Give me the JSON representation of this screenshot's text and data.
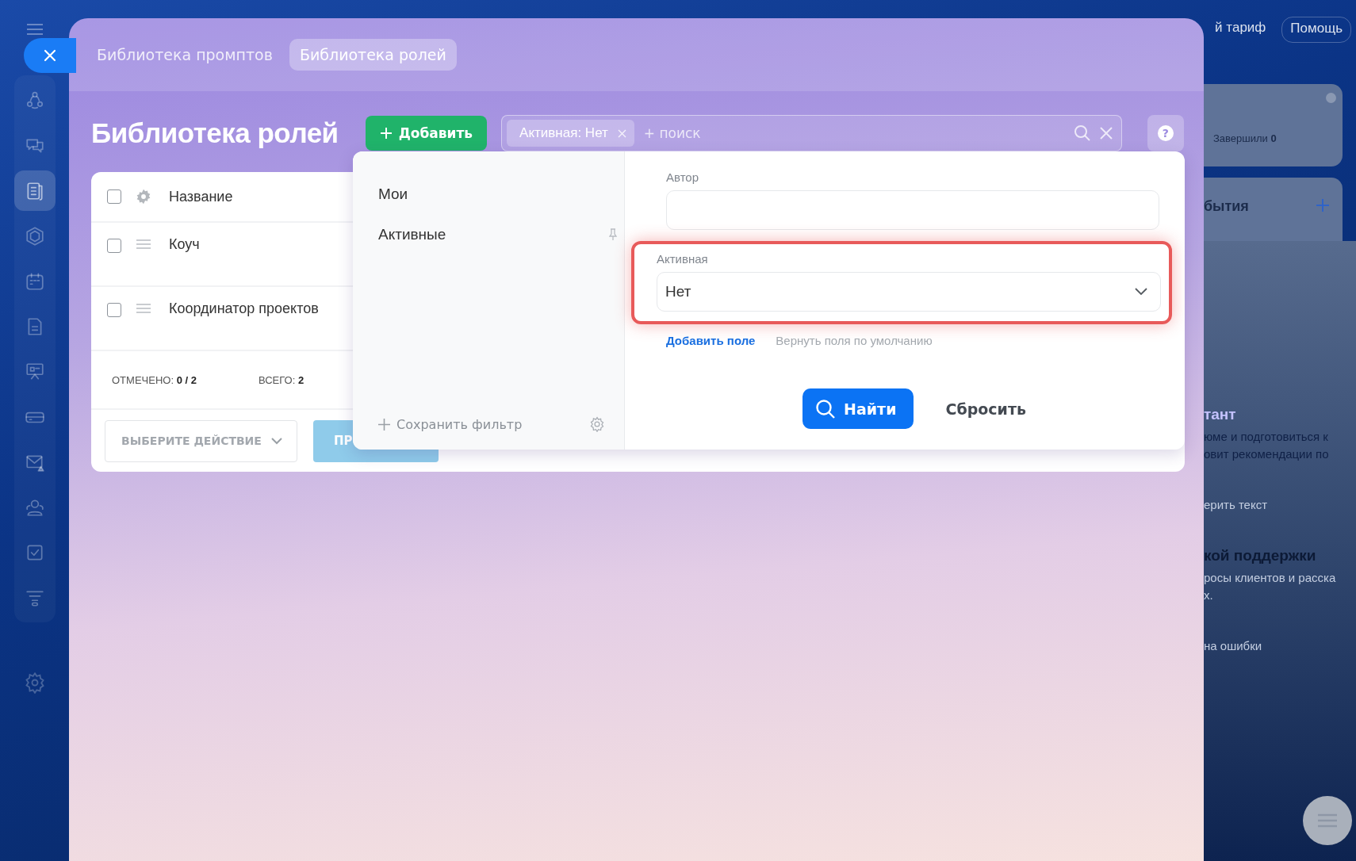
{
  "sidebar": {
    "items": [
      {
        "kind": "network",
        "selected": false
      },
      {
        "kind": "chat",
        "selected": false
      },
      {
        "kind": "document",
        "selected": true
      },
      {
        "kind": "hexagon",
        "selected": false
      },
      {
        "kind": "calendar",
        "selected": false
      },
      {
        "kind": "file",
        "selected": false
      },
      {
        "kind": "presentation",
        "selected": false
      },
      {
        "kind": "drive",
        "selected": false
      },
      {
        "kind": "mail",
        "selected": false
      },
      {
        "kind": "people",
        "selected": false
      },
      {
        "kind": "task",
        "selected": false
      },
      {
        "kind": "funnel",
        "selected": false
      }
    ]
  },
  "panel": {
    "tabs": [
      {
        "label": "Библиотека промптов",
        "selected": false
      },
      {
        "label": "Библиотека ролей",
        "selected": true
      }
    ],
    "title": "Библиотека ролей",
    "add_button": "Добавить",
    "search": {
      "chip": "Активная: Нет",
      "placeholder": "+ поиск"
    },
    "help_button": "?",
    "table": {
      "header_checked": false,
      "column": "Название",
      "rows": [
        {
          "name": "Коуч",
          "checked": false
        },
        {
          "name": "Координатор проектов",
          "checked": false
        }
      ],
      "marked_label": "ОТМЕЧЕНО:",
      "marked_value": "0 / 2",
      "total_label": "ВСЕГО:",
      "total_value": "2",
      "action_select": "ВЫБЕРИТЕ ДЕЙСТВИЕ",
      "apply_button": {
        "label": "ПР",
        "disabled": true
      }
    },
    "filter": {
      "presets": [
        {
          "label": "Мои",
          "pinned": false
        },
        {
          "label": "Активные",
          "pinned": true
        }
      ],
      "save_filter": "Сохранить фильтр",
      "fields": [
        {
          "kind": "text",
          "label": "Автор",
          "highlighted": false
        },
        {
          "kind": "select",
          "label": "Активная",
          "value": "Нет",
          "highlighted": true
        }
      ],
      "add_field": "Добавить поле",
      "reset_fields": "Вернуть поля по умолчанию",
      "find_button": "Найти",
      "reset_button": "Сбросить"
    }
  },
  "background_page": {
    "top_buttons": [
      "й тариф",
      "Помощь"
    ],
    "stats_label": "Завершили",
    "stats_value": "0",
    "events_title": "бытия",
    "blocks": [
      {
        "kind": "accent",
        "title": "тант",
        "lines": [
          "юме и подготовиться к",
          "овит рекомендации по"
        ]
      },
      {
        "kind": "plain",
        "lines": [
          "ерить текст"
        ]
      },
      {
        "kind": "heading",
        "title": "кой поддержки",
        "lines": [
          "росы клиентов и расска",
          "х."
        ]
      },
      {
        "kind": "plain",
        "lines": [
          "на ошибки"
        ]
      }
    ]
  }
}
